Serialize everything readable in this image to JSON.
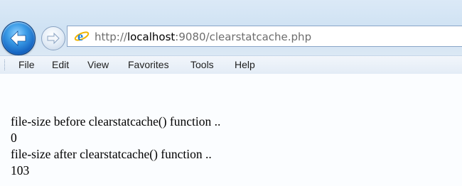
{
  "browser": {
    "address": {
      "scheme": "http://",
      "host": "localhost",
      "rest": ":9080/clearstatcache.php",
      "icon": "ie-logo-icon"
    },
    "nav": {
      "back_icon": "back-arrow-icon",
      "forward_icon": "forward-arrow-icon"
    },
    "menu": {
      "file": "File",
      "edit": "Edit",
      "view": "View",
      "favorites": "Favorites",
      "tools": "Tools",
      "help": "Help"
    },
    "colors": {
      "chrome": "#cfe2f3",
      "back_button": "#1665c2",
      "page_background": "#fbfdff"
    }
  },
  "page": {
    "lines": [
      "file-size before clearstatcache() function ..",
      "0",
      "file-size after clearstatcache() function ..",
      "103"
    ]
  }
}
